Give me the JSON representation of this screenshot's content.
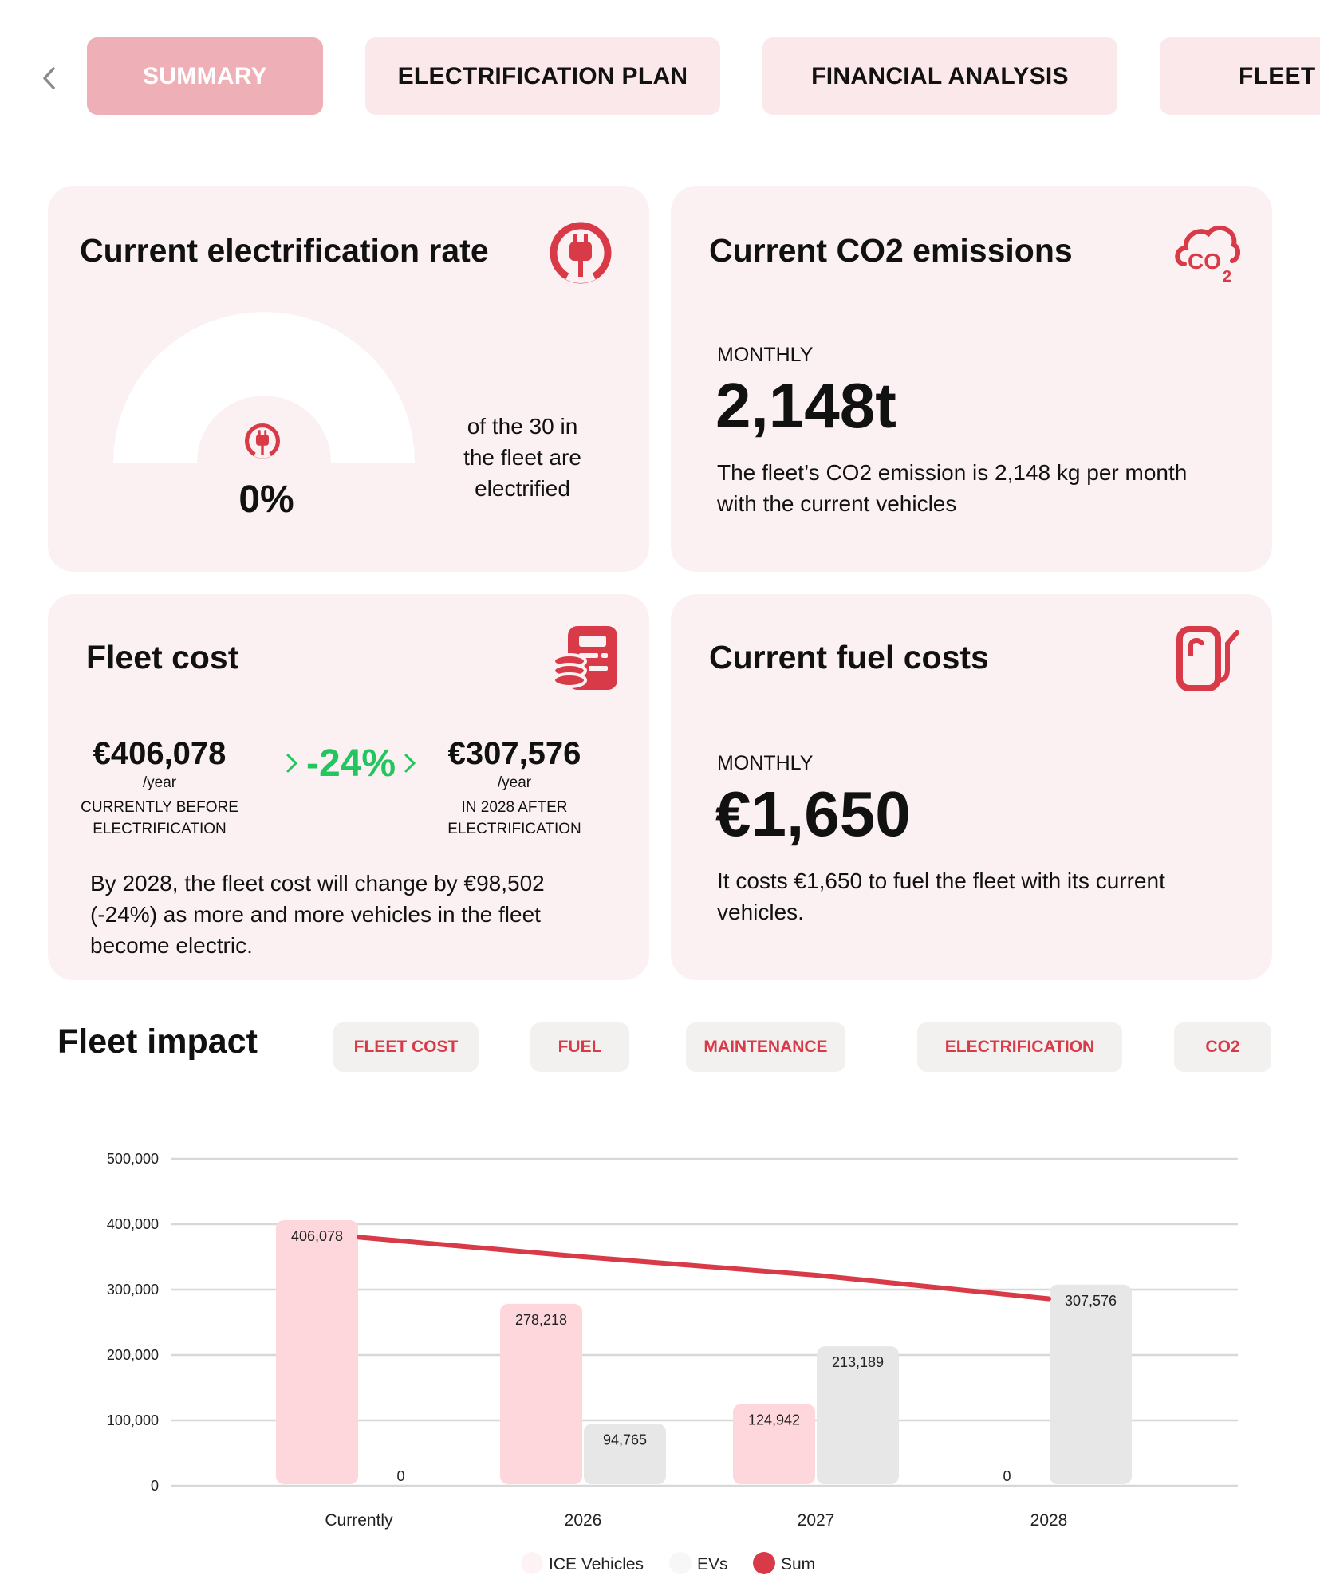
{
  "nav": {
    "back_icon": "chevron-left-icon",
    "tabs": [
      {
        "label": "SUMMARY",
        "active": true
      },
      {
        "label": "ELECTRIFICATION PLAN",
        "active": false
      },
      {
        "label": "FINANCIAL ANALYSIS",
        "active": false
      },
      {
        "label": "FLEET A",
        "active": false
      }
    ]
  },
  "electrification": {
    "title": "Current electrification rate",
    "icon": "plug-icon",
    "rate": "0%",
    "rate_value": 0,
    "description_lines": [
      "of the 30 in",
      "the fleet are",
      "electrified"
    ]
  },
  "co2": {
    "title": "Current CO2 emissions",
    "icon": "co2-cloud-icon",
    "period": "MONTHLY",
    "value": "2,148t",
    "description_lines": [
      "The fleet’s CO2 emission is 2,148 kg per month",
      "with the current vehicles"
    ]
  },
  "fleet_cost": {
    "title": "Fleet cost",
    "icon": "cost-coins-icon",
    "before": {
      "value": "€406,078",
      "unit": "/year",
      "label_lines": [
        "CURRENTLY BEFORE",
        "ELECTRIFICATION"
      ]
    },
    "change": "-24%",
    "after": {
      "value": "€307,576",
      "unit": "/year",
      "label_lines": [
        "IN 2028 AFTER",
        "ELECTRIFICATION"
      ]
    },
    "description_lines": [
      "By 2028, the fleet cost will change by €98,502",
      "(-24%) as more and more vehicles in the fleet",
      "become electric."
    ]
  },
  "fuel": {
    "title": "Current fuel costs",
    "icon": "fuel-pump-icon",
    "period": "MONTHLY",
    "value": "€1,650",
    "description_lines": [
      "It costs €1,650 to fuel the fleet with its current",
      "vehicles."
    ]
  },
  "impact": {
    "title": "Fleet impact",
    "filters": [
      "FLEET COST",
      "FUEL",
      "MAINTENANCE",
      "ELECTRIFICATION",
      "CO2"
    ]
  },
  "colors": {
    "accent": "#d83a47",
    "ice": "#fdd7dc",
    "ev": "#e7e7e7",
    "sum_line": "#d83a47",
    "positive": "#22c55e",
    "card_bg": "#fbf1f2"
  },
  "chart_data": {
    "type": "bar",
    "categories": [
      "Currently",
      "2026",
      "2027",
      "2028"
    ],
    "series": [
      {
        "name": "ICE Vehicles",
        "values": [
          406078,
          278218,
          124942,
          0
        ],
        "labels": [
          "406,078",
          "278,218",
          "124,942",
          "0"
        ]
      },
      {
        "name": "EVs",
        "values": [
          0,
          94765,
          213189,
          307576
        ],
        "labels": [
          "0",
          "94,765",
          "213,189",
          "307,576"
        ]
      },
      {
        "name": "Sum",
        "type": "line",
        "values": [
          380000,
          350000,
          322000,
          286000
        ]
      }
    ],
    "ylim": [
      0,
      500000
    ],
    "yticks": [
      0,
      100000,
      200000,
      300000,
      400000,
      500000
    ],
    "ytick_labels": [
      "0",
      "100,000",
      "200,000",
      "300,000",
      "400,000",
      "500,000"
    ],
    "grid": true,
    "legend_position": "bottom"
  }
}
